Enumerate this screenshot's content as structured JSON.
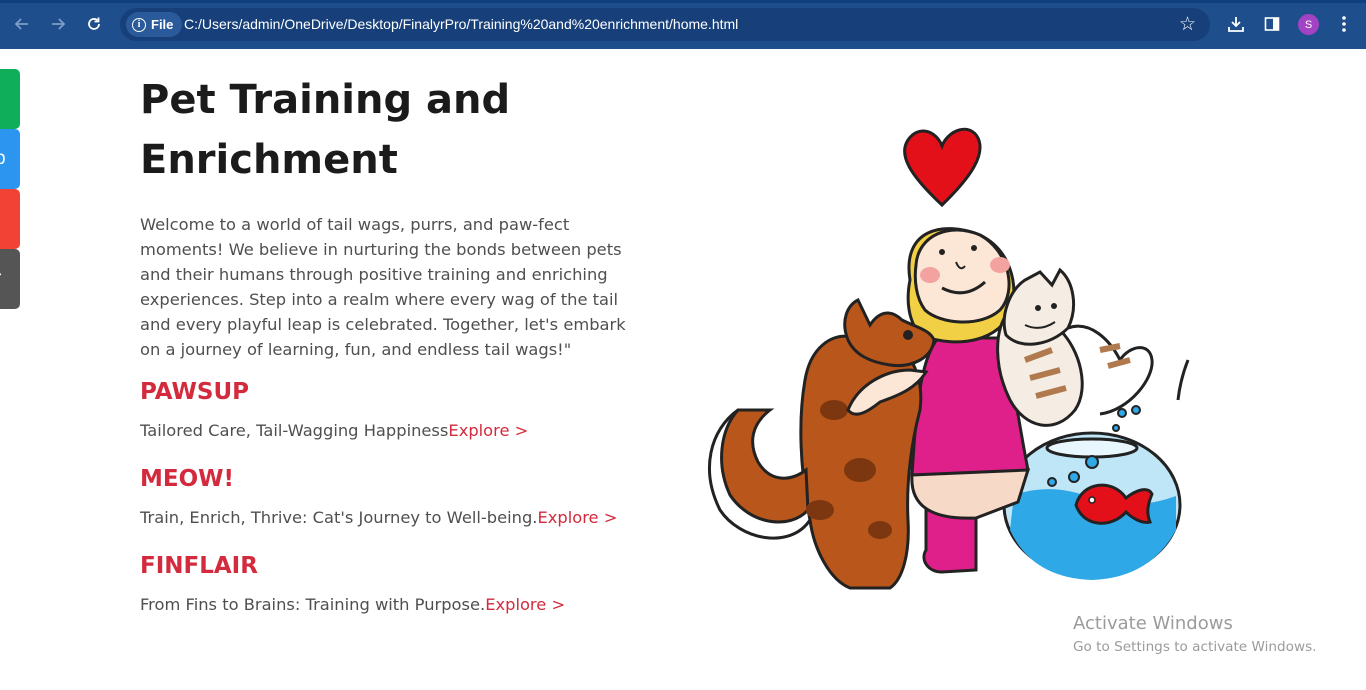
{
  "browser": {
    "chip_label": "File",
    "url": "C:/Users/admin/OneDrive/Desktop/FinalyrPro/Training%20and%20enrichment/home.html",
    "profile_initial": "S"
  },
  "side_tabs": [
    {
      "letter": "",
      "color": "#0fae5a"
    },
    {
      "letter": "p",
      "color": "#2c95f0"
    },
    {
      "letter": "",
      "color": "#f24236"
    },
    {
      "letter": "r",
      "color": "#555555"
    }
  ],
  "page": {
    "title": "Pet Training and Enrichment",
    "intro": "Welcome to a world of tail wags, purrs, and paw-fect moments! We believe in nurturing the bonds between pets and their humans through positive training and enriching experiences. Step into a realm where every wag of the tail and every playful leap is celebrated. Together, let's embark on a journey of learning, fun, and endless tail wags!\"",
    "sections": [
      {
        "heading": "PAWSUP",
        "tagline": "Tailored Care, Tail-Wagging Happiness",
        "link": "Explore >"
      },
      {
        "heading": "MEOW!",
        "tagline": "Train, Enrich, Thrive: Cat's Journey to Well-being.",
        "link": "Explore >"
      },
      {
        "heading": "FINFLAIR",
        "tagline": "From Fins to Brains: Training with Purpose.",
        "link": "Explore >"
      }
    ],
    "accent_color": "#d32a3d"
  },
  "watermark": {
    "line1": "Activate Windows",
    "line2": "Go to Settings to activate Windows."
  }
}
